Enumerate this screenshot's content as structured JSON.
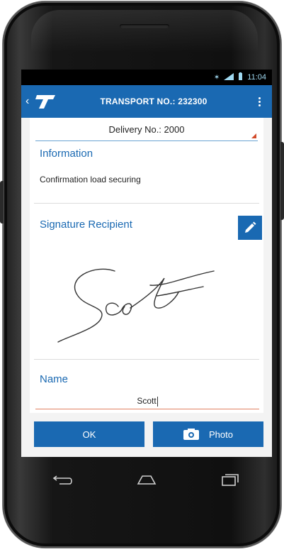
{
  "status_bar": {
    "time": "11:04"
  },
  "app_bar": {
    "title": "TRANSPORT NO.: 232300",
    "back_icon": "chevron-left-icon",
    "logo": "T-logo",
    "menu_icon": "more-vert-icon"
  },
  "delivery": {
    "label": "Delivery No.: 2000"
  },
  "information": {
    "title": "Information",
    "text": "Confirmation load securing"
  },
  "signature": {
    "title": "Signature Recipient",
    "edit_icon": "pencil-icon",
    "signature_text": "Scott"
  },
  "name": {
    "title": "Name",
    "value": "Scott"
  },
  "actions": {
    "ok_label": "OK",
    "photo_label": "Photo",
    "photo_icon": "camera-icon"
  },
  "navigation": {
    "back": "back-icon",
    "home": "home-icon",
    "recents": "recents-icon"
  },
  "colors": {
    "primary": "#1a69b2",
    "accent": "#d24b2a",
    "status_text": "#9fd8f0"
  }
}
